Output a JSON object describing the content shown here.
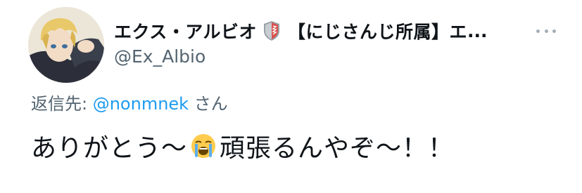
{
  "tweet": {
    "display_name": "エクス・アルビオ",
    "badge_icon": "shield-badge-icon",
    "affiliation": "【にじさんじ所属】エ",
    "ellipsis": "...",
    "handle": "@Ex_Albio",
    "more_icon": "more-dots-icon",
    "reply_prefix": "返信先: ",
    "reply_mention": "@nonmnek",
    "reply_suffix": " さん",
    "text_before_emoji": "ありがとう〜",
    "emoji": "loudly-crying-face-emoji",
    "text_after_emoji": "頑張るんやぞ〜！！"
  },
  "colors": {
    "text_primary": "#0f1419",
    "text_secondary": "#536471",
    "link": "#1d9bf0",
    "badge_red": "#d9534f",
    "badge_gray": "#9aa1a8"
  }
}
